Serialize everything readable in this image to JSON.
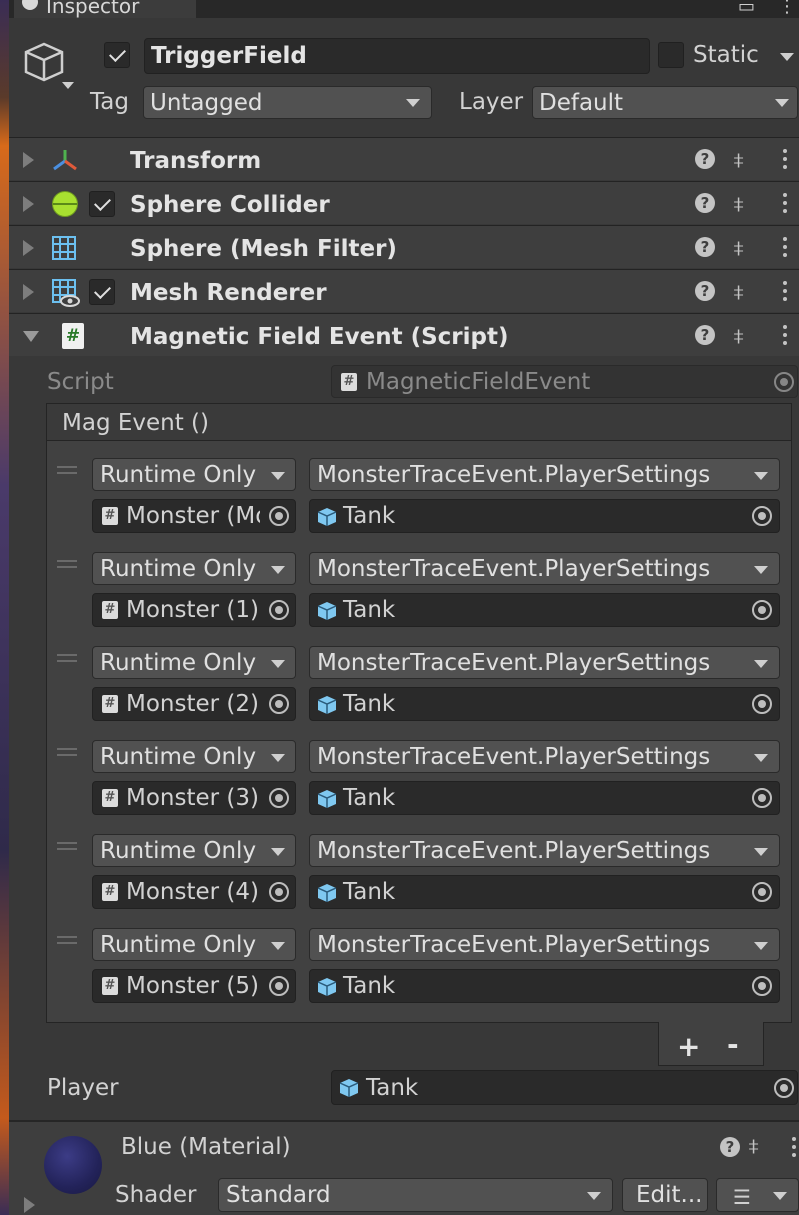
{
  "window": {
    "tab_title": "Inspector"
  },
  "gameobject": {
    "active": true,
    "name": "TriggerField",
    "static_label": "Static",
    "static_checked": false,
    "tag_label": "Tag",
    "tag_value": "Untagged",
    "layer_label": "Layer",
    "layer_value": "Default"
  },
  "components": [
    {
      "name": "Transform",
      "icon": "transform-icon",
      "has_toggle": false,
      "expanded": false
    },
    {
      "name": "Sphere Collider",
      "icon": "sphere-collider-icon",
      "has_toggle": true,
      "enabled": true,
      "expanded": false
    },
    {
      "name": "Sphere (Mesh Filter)",
      "icon": "mesh-filter-icon",
      "has_toggle": false,
      "expanded": false
    },
    {
      "name": "Mesh Renderer",
      "icon": "mesh-renderer-icon",
      "has_toggle": true,
      "enabled": true,
      "expanded": false
    },
    {
      "name": "Magnetic Field Event (Script)",
      "icon": "script-icon",
      "has_toggle": false,
      "expanded": true
    }
  ],
  "script_component": {
    "script_label": "Script",
    "script_value": "MagneticFieldEvent",
    "event_title": "Mag Event ()",
    "listeners": [
      {
        "mode": "Runtime Only",
        "function": "MonsterTraceEvent.PlayerSettings",
        "target": "Monster (Mo",
        "argument": "Tank"
      },
      {
        "mode": "Runtime Only",
        "function": "MonsterTraceEvent.PlayerSettings",
        "target": "Monster (1)",
        "argument": "Tank"
      },
      {
        "mode": "Runtime Only",
        "function": "MonsterTraceEvent.PlayerSettings",
        "target": "Monster (2)",
        "argument": "Tank"
      },
      {
        "mode": "Runtime Only",
        "function": "MonsterTraceEvent.PlayerSettings",
        "target": "Monster (3)",
        "argument": "Tank"
      },
      {
        "mode": "Runtime Only",
        "function": "MonsterTraceEvent.PlayerSettings",
        "target": "Monster (4)",
        "argument": "Tank"
      },
      {
        "mode": "Runtime Only",
        "function": "MonsterTraceEvent.PlayerSettings",
        "target": "Monster (5)",
        "argument": "Tank"
      }
    ],
    "add_label": "+",
    "remove_label": "-",
    "player_label": "Player",
    "player_value": "Tank"
  },
  "material": {
    "name": "Blue (Material)",
    "shader_label": "Shader",
    "shader_value": "Standard",
    "edit_label": "Edit..."
  },
  "colors": {
    "panel_bg": "#383838",
    "header_bg": "#3e3e3e",
    "field_bg": "#2a2a2a",
    "dropdown_bg": "#515151",
    "text": "#d2d2d2"
  }
}
